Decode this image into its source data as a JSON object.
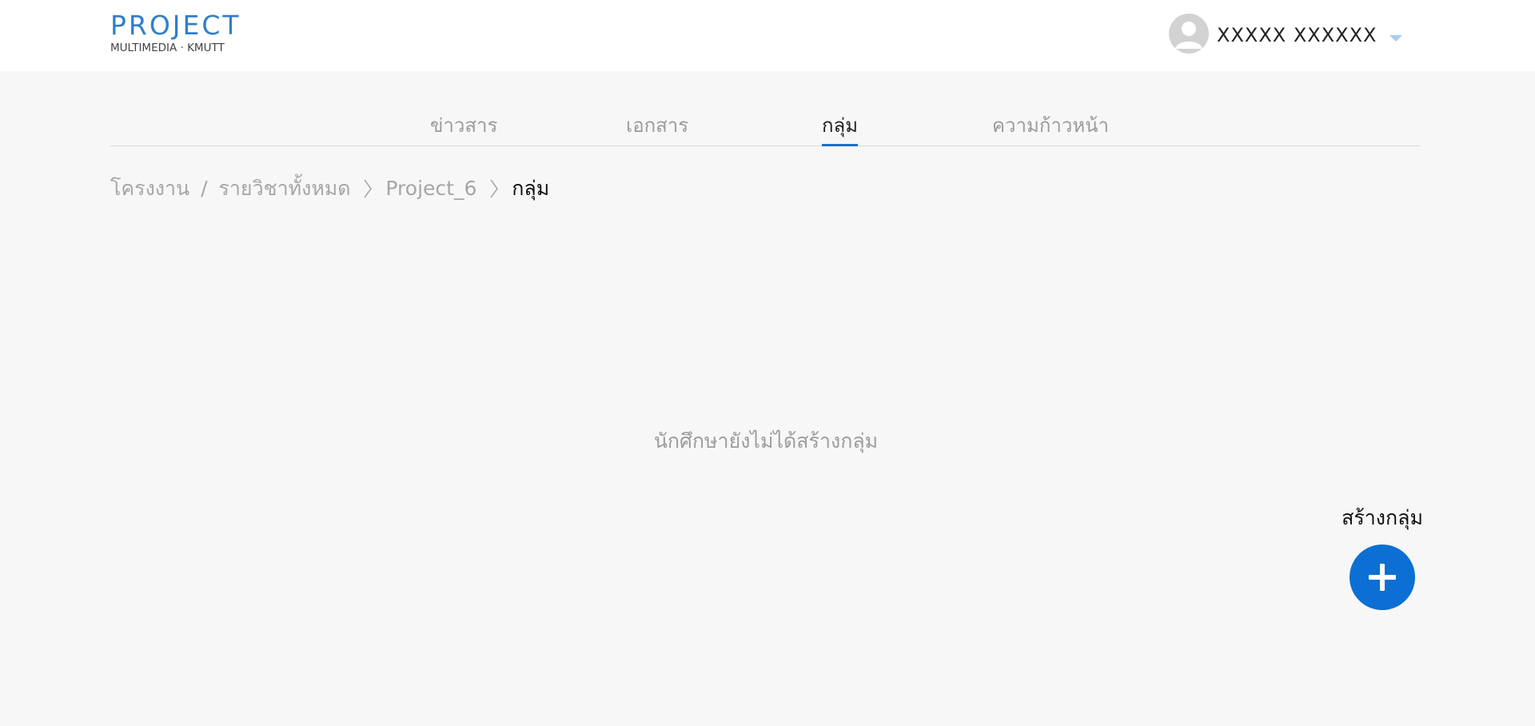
{
  "logo": {
    "main": "PROJECT",
    "sub": "MULTIMEDIA · KMUTT"
  },
  "user": {
    "name": "XXXXX XXXXXX",
    "avatar_icon": "user-avatar-icon",
    "menu_icon": "caret-down-icon"
  },
  "tabs": [
    {
      "label": "ข่าวสาร",
      "active": false
    },
    {
      "label": "เอกสาร",
      "active": false
    },
    {
      "label": "กลุ่ม",
      "active": true
    },
    {
      "label": "ความก้าวหน้า",
      "active": false
    }
  ],
  "breadcrumb": {
    "root": "โครงงาน",
    "slash": "/",
    "all_courses": "รายวิชาทั้งหมด",
    "project": "Project_6",
    "current": "กลุ่ม"
  },
  "main": {
    "empty_message": "นักศึกษายังไม่ได้สร้างกลุ่ม",
    "create_label": "สร้างกลุ่ม",
    "create_icon": "plus-icon"
  },
  "colors": {
    "accent": "#0b6fd3",
    "tab_underline": "#1f6fc5",
    "logo_blue": "#2f7fc8",
    "background": "#f7f7f7"
  }
}
